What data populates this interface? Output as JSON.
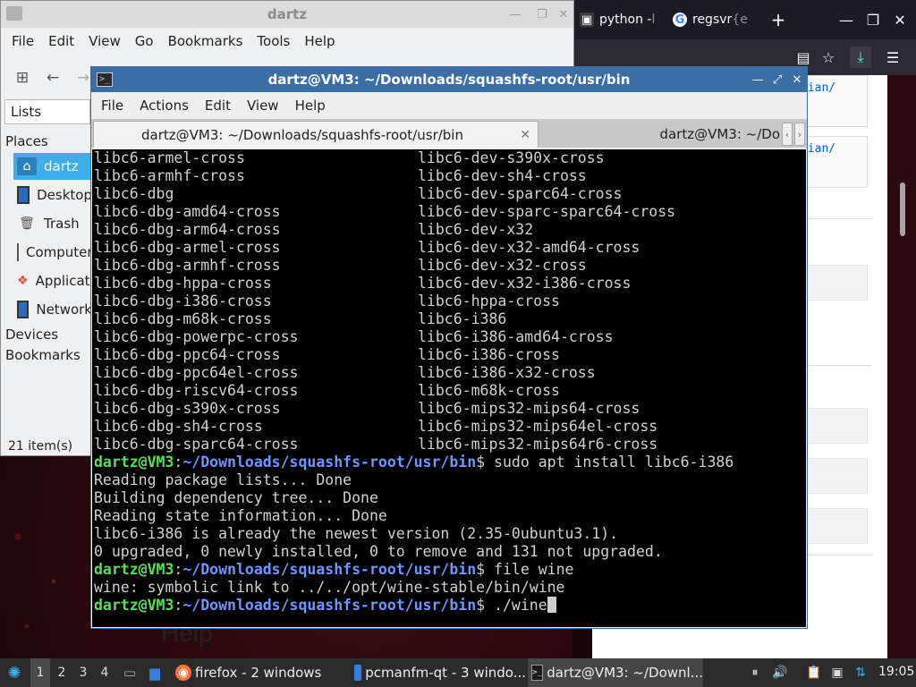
{
  "firefox": {
    "tabs": [
      {
        "label": "python - ",
        "dim": "l"
      },
      {
        "label": "regsvr ",
        "dim": "{e"
      }
    ],
    "new_tab": "+",
    "page": {
      "code_snippets": [
        "bian/",
        "bian/"
      ],
      "help_heading": "Help"
    }
  },
  "file_manager": {
    "title": "dartz",
    "menu": [
      "File",
      "Edit",
      "View",
      "Go",
      "Bookmarks",
      "Tools",
      "Help"
    ],
    "side_selector": "Lists",
    "places_header": "Places",
    "places": [
      {
        "label": "dartz",
        "icon": "home-folder-icon"
      },
      {
        "label": "Desktop",
        "icon": "desktop-icon"
      },
      {
        "label": "Trash",
        "icon": "trash-icon"
      },
      {
        "label": "Computer",
        "icon": "computer-icon"
      },
      {
        "label": "Applications",
        "icon": "applications-icon"
      },
      {
        "label": "Network",
        "icon": "network-icon"
      }
    ],
    "devices_header": "Devices",
    "bookmarks_header": "Bookmarks",
    "status": "21 item(s)"
  },
  "terminal": {
    "title": "dartz@VM3: ~/Downloads/squashfs-root/usr/bin",
    "menu": [
      "File",
      "Actions",
      "Edit",
      "View",
      "Help"
    ],
    "tabs": [
      {
        "label": "dartz@VM3: ~/Downloads/squashfs-root/usr/bin",
        "active": true
      },
      {
        "label": "dartz@VM3: ~/Do",
        "active": false
      }
    ],
    "package_list": [
      [
        "libc6-armel-cross",
        "libc6-dev-s390x-cross"
      ],
      [
        "libc6-armhf-cross",
        "libc6-dev-sh4-cross"
      ],
      [
        "libc6-dbg",
        "libc6-dev-sparc64-cross"
      ],
      [
        "libc6-dbg-amd64-cross",
        "libc6-dev-sparc-sparc64-cross"
      ],
      [
        "libc6-dbg-arm64-cross",
        "libc6-dev-x32"
      ],
      [
        "libc6-dbg-armel-cross",
        "libc6-dev-x32-amd64-cross"
      ],
      [
        "libc6-dbg-armhf-cross",
        "libc6-dev-x32-cross"
      ],
      [
        "libc6-dbg-hppa-cross",
        "libc6-dev-x32-i386-cross"
      ],
      [
        "libc6-dbg-i386-cross",
        "libc6-hppa-cross"
      ],
      [
        "libc6-dbg-m68k-cross",
        "libc6-i386"
      ],
      [
        "libc6-dbg-powerpc-cross",
        "libc6-i386-amd64-cross"
      ],
      [
        "libc6-dbg-ppc64-cross",
        "libc6-i386-cross"
      ],
      [
        "libc6-dbg-ppc64el-cross",
        "libc6-i386-x32-cross"
      ],
      [
        "libc6-dbg-riscv64-cross",
        "libc6-m68k-cross"
      ],
      [
        "libc6-dbg-s390x-cross",
        "libc6-mips32-mips64-cross"
      ],
      [
        "libc6-dbg-sh4-cross",
        "libc6-mips32-mips64el-cross"
      ],
      [
        "libc6-dbg-sparc64-cross",
        "libc6-mips32-mips64r6-cross"
      ]
    ],
    "prompt_user": "dartz@VM3",
    "prompt_path": "~/Downloads/squashfs-root/usr/bin",
    "commands": [
      {
        "cmd": " sudo apt install libc6-i386"
      },
      {
        "cmd": " file wine"
      },
      {
        "cmd": " ./wine"
      }
    ],
    "apt_output": [
      "Reading package lists... Done",
      "Building dependency tree... Done",
      "Reading state information... Done",
      "libc6-i386 is already the newest version (2.35-0ubuntu3.1).",
      "0 upgraded, 0 newly installed, 0 to remove and 131 not upgraded."
    ],
    "file_output": "wine: symbolic link to ../../opt/wine-stable/bin/wine"
  },
  "panel": {
    "desktops": [
      "1",
      "2",
      "3",
      "4"
    ],
    "tasks": [
      {
        "label": "firefox - 2 windows",
        "icon": "firefox-icon"
      },
      {
        "label": "pcmanfm-qt - 3 windo...",
        "icon": "folder-icon"
      },
      {
        "label": "dartz@VM3: ~/Downl...",
        "icon": "terminal-icon"
      }
    ],
    "clock": "19:05"
  }
}
